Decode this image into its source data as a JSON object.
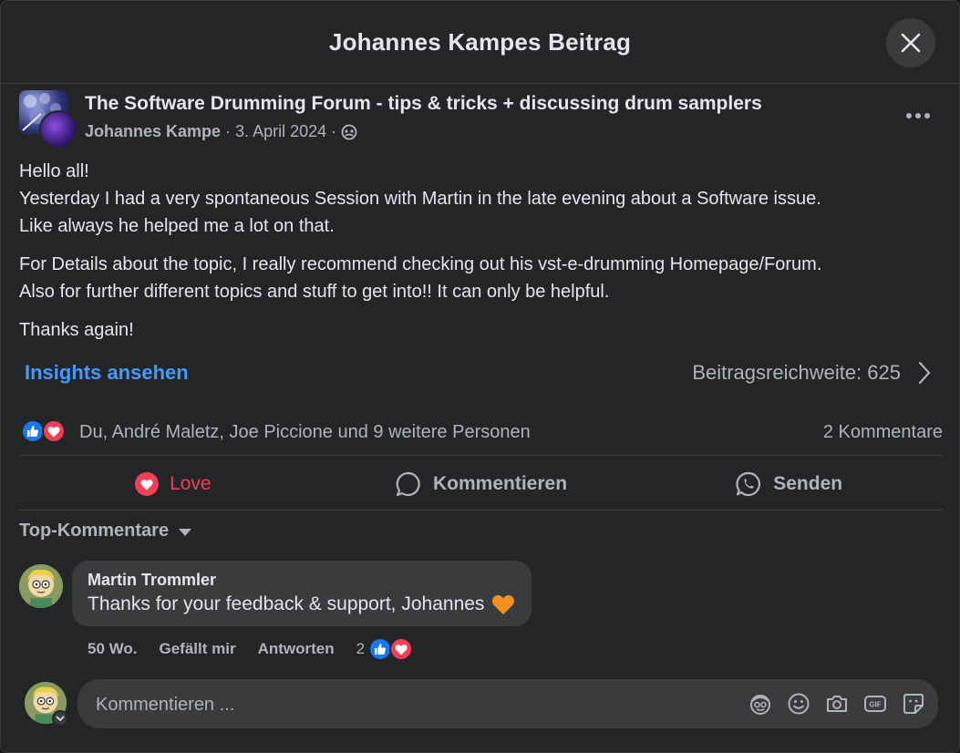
{
  "modal": {
    "title": "Johannes Kampes Beitrag"
  },
  "post": {
    "group_name": "The Software Drumming Forum - tips & tricks + discussing drum samplers",
    "author": "Johannes Kampe",
    "date": "3. April 2024",
    "paragraphs": [
      "Hello all!\nYesterday I had a very spontaneous Session with Martin in the late evening about a Software issue.\nLike always he helped me a lot on that.",
      "For Details about the topic, I really recommend checking out his vst-e-drumming Homepage/Forum.\nAlso for further different topics and stuff to get into!! It can only be helpful.",
      "Thanks again!"
    ],
    "insights_label": "Insights ansehen",
    "reach_label": "Beitragsreichweite: 625",
    "reactions_text": "Du, André Maletz, Joe Piccione und 9 weitere Personen",
    "comments_count": "2 Kommentare"
  },
  "actions": {
    "love": "Love",
    "comment": "Kommentieren",
    "send": "Senden"
  },
  "comments_section": {
    "sort_label": "Top-Kommentare",
    "items": [
      {
        "author": "Martin Trommler",
        "text": "Thanks for your feedback & support, Johannes",
        "time": "50 Wo.",
        "like_label": "Gefällt mir",
        "reply_label": "Antworten",
        "reaction_count": "2"
      }
    ]
  },
  "composer": {
    "placeholder": "Kommentieren ..."
  },
  "icons": {
    "close": "close-icon",
    "more": "more-icon",
    "audience": "group-audience-icon",
    "chevron": "chevron-right-icon",
    "like": "like-icon",
    "love": "love-icon",
    "comment": "comment-icon",
    "send": "whatsapp-icon",
    "caret": "caret-down-icon",
    "avatar_sticker": "avatar-sticker-icon",
    "emoji": "emoji-icon",
    "camera": "camera-icon",
    "gif": "gif-icon",
    "sticker": "sticker-icon"
  },
  "colors": {
    "accent": "#4599ff",
    "love": "#f33e58",
    "like": "#1877f2",
    "background": "#242526"
  }
}
